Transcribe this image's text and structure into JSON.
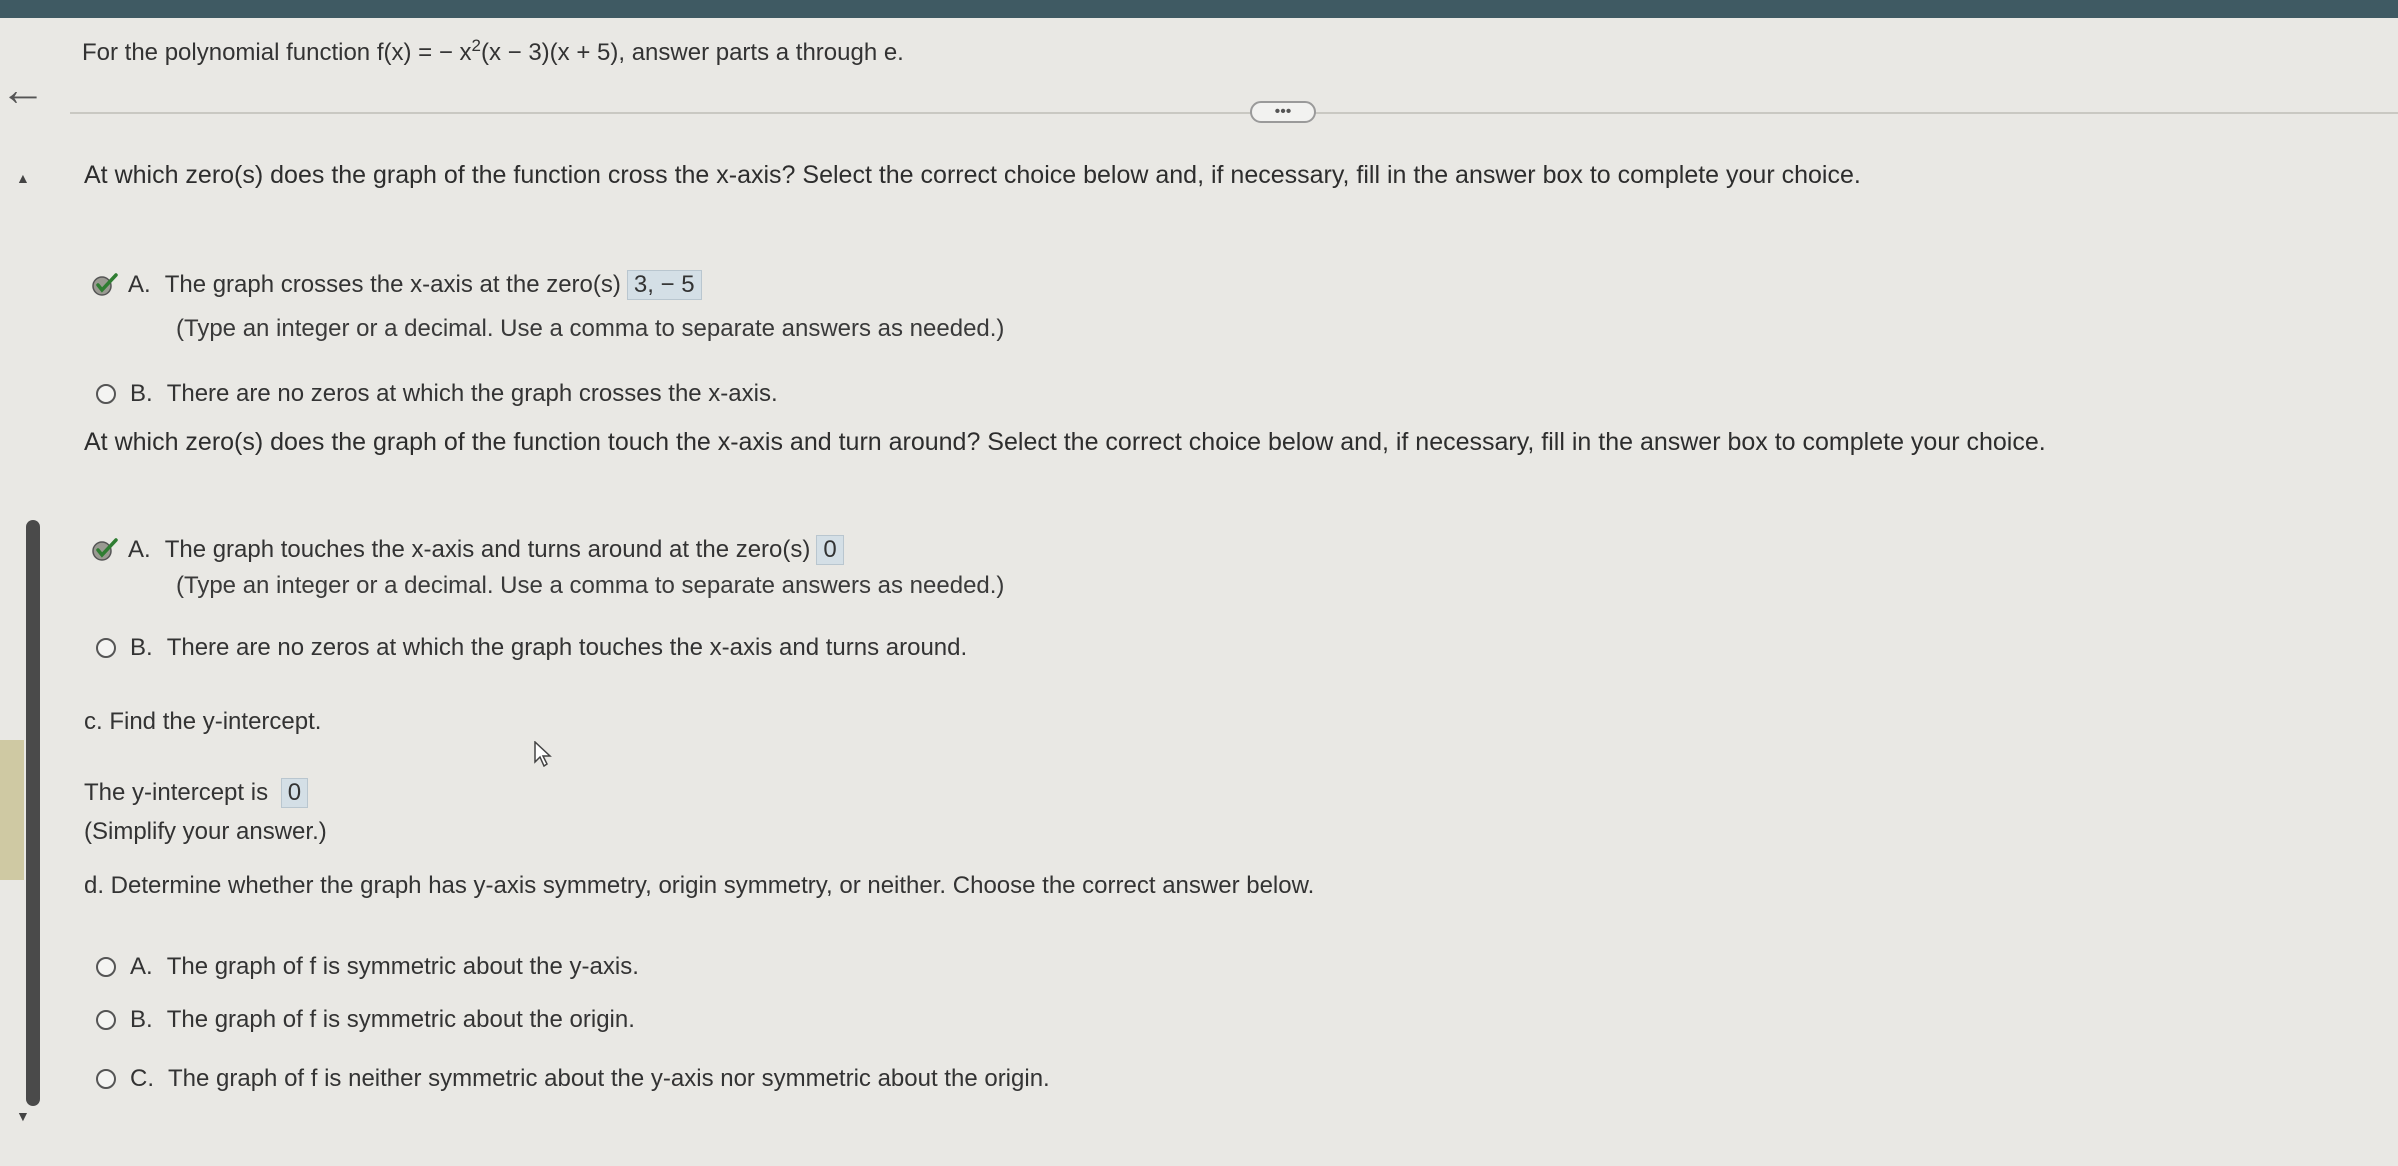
{
  "header": {
    "intro": "For the polynomial function ",
    "func_prefix": "f(x) = − x",
    "func_exp": "2",
    "func_suffix": "(x − 3)(x + 5)",
    "outro": ", answer parts a through e."
  },
  "more_label": "•••",
  "part_a": {
    "question": "At which zero(s) does the graph of the function cross the x-axis? Select the correct choice below and, if necessary, fill in the answer box to complete your choice.",
    "choice_a_letter": "A.",
    "choice_a_text": "The graph crosses the x-axis at the zero(s)",
    "choice_a_answer": "3, − 5",
    "hint": "(Type an integer or a decimal. Use a comma to separate answers as needed.)",
    "choice_b_letter": "B.",
    "choice_b_text": "There are no zeros at which the graph crosses the x-axis."
  },
  "part_b": {
    "question": "At which zero(s) does the graph of the function touch the x-axis and turn around? Select the correct choice below and, if necessary, fill in the answer box to complete your choice.",
    "choice_a_letter": "A.",
    "choice_a_text": "The graph touches the x-axis and turns around at the zero(s)",
    "choice_a_answer": "0",
    "hint": "(Type an integer or a decimal. Use a comma to separate answers as needed.)",
    "choice_b_letter": "B.",
    "choice_b_text": "There are no zeros at which the graph touches the x-axis and turns around."
  },
  "part_c": {
    "question": "c. Find the y-intercept.",
    "label": "The y-intercept is",
    "answer": "0",
    "hint": "(Simplify your answer.)"
  },
  "part_d": {
    "question": "d. Determine whether the graph has y-axis symmetry, origin symmetry, or neither. Choose the correct answer below.",
    "choice_a_letter": "A.",
    "choice_a_text": "The graph of f is symmetric about the y-axis.",
    "choice_b_letter": "B.",
    "choice_b_text": "The graph of f is symmetric about the origin.",
    "choice_c_letter": "C.",
    "choice_c_text": "The graph of f is neither symmetric about the y-axis nor symmetric about the origin."
  },
  "colors": {
    "background": "#e9e8e4",
    "topbar": "#3f5a63",
    "answer_box": "#d4dfe6",
    "check_green": "#2f7d32"
  }
}
